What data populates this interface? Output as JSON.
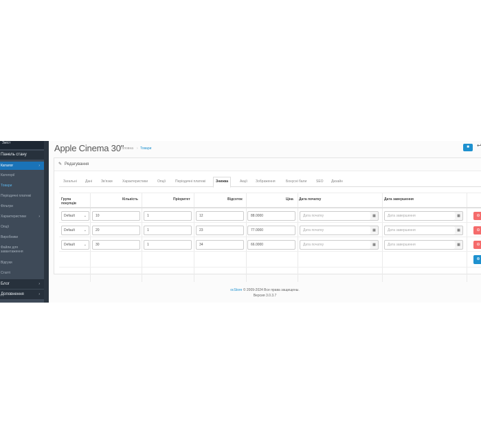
{
  "sidebar": {
    "top_cut": "Зміст",
    "items": [
      {
        "label": "Панель стану"
      },
      {
        "label": "Каталог"
      },
      {
        "label": "Категорії"
      },
      {
        "label": "Товари"
      },
      {
        "label": "Періодичні платежі"
      },
      {
        "label": "Фільтри"
      },
      {
        "label": "Характеристики"
      },
      {
        "label": "Опції"
      },
      {
        "label": "Виробники"
      },
      {
        "label": "Файли для"
      },
      {
        "label": "Відгуки"
      },
      {
        "label": "Статті"
      },
      {
        "label": "Блог"
      },
      {
        "label": "Доповнення"
      }
    ],
    "downloads_line2": "завантаження"
  },
  "header": {
    "title": "Apple Cinema 30\"",
    "breadcrumb": {
      "home": "Головна",
      "separator": "›",
      "current": "Товари"
    }
  },
  "panel": {
    "title": "Редагування",
    "tabs": [
      "Загальні",
      "Дані",
      "Зв'язки",
      "Характеристики",
      "Опції",
      "Періодичні платежі",
      "Знижка",
      "Акції",
      "Зображення",
      "Бонусні бали",
      "SEO",
      "Дизайн"
    ],
    "active_tab": "Знижка"
  },
  "table": {
    "headers": {
      "group_line1": "Група",
      "group_line2": "покупців",
      "quantity": "Кількість",
      "priority": "Пріоритет",
      "percent": "Відсоток",
      "price": "Ціна",
      "date_start": "Дата початку",
      "date_end": "Дата завершення"
    },
    "date_start_placeholder": "Дата початку",
    "date_end_placeholder": "Дата завершення",
    "rows": [
      {
        "group": "Default",
        "quantity": "10",
        "priority": "1",
        "percent": "12",
        "price": "88.0000"
      },
      {
        "group": "Default",
        "quantity": "20",
        "priority": "1",
        "percent": "23",
        "price": "77.0000"
      },
      {
        "group": "Default",
        "quantity": "30",
        "priority": "1",
        "percent": "34",
        "price": "66.0000"
      }
    ]
  },
  "footer": {
    "brand": "ocStore",
    "copyright": "© 2009-2024 Все права защищены.",
    "version": "Версия 3.0.3.7"
  },
  "colors": {
    "accent": "#1e91cf",
    "danger": "#f56b6b",
    "sidebar": "#3e4a58"
  }
}
